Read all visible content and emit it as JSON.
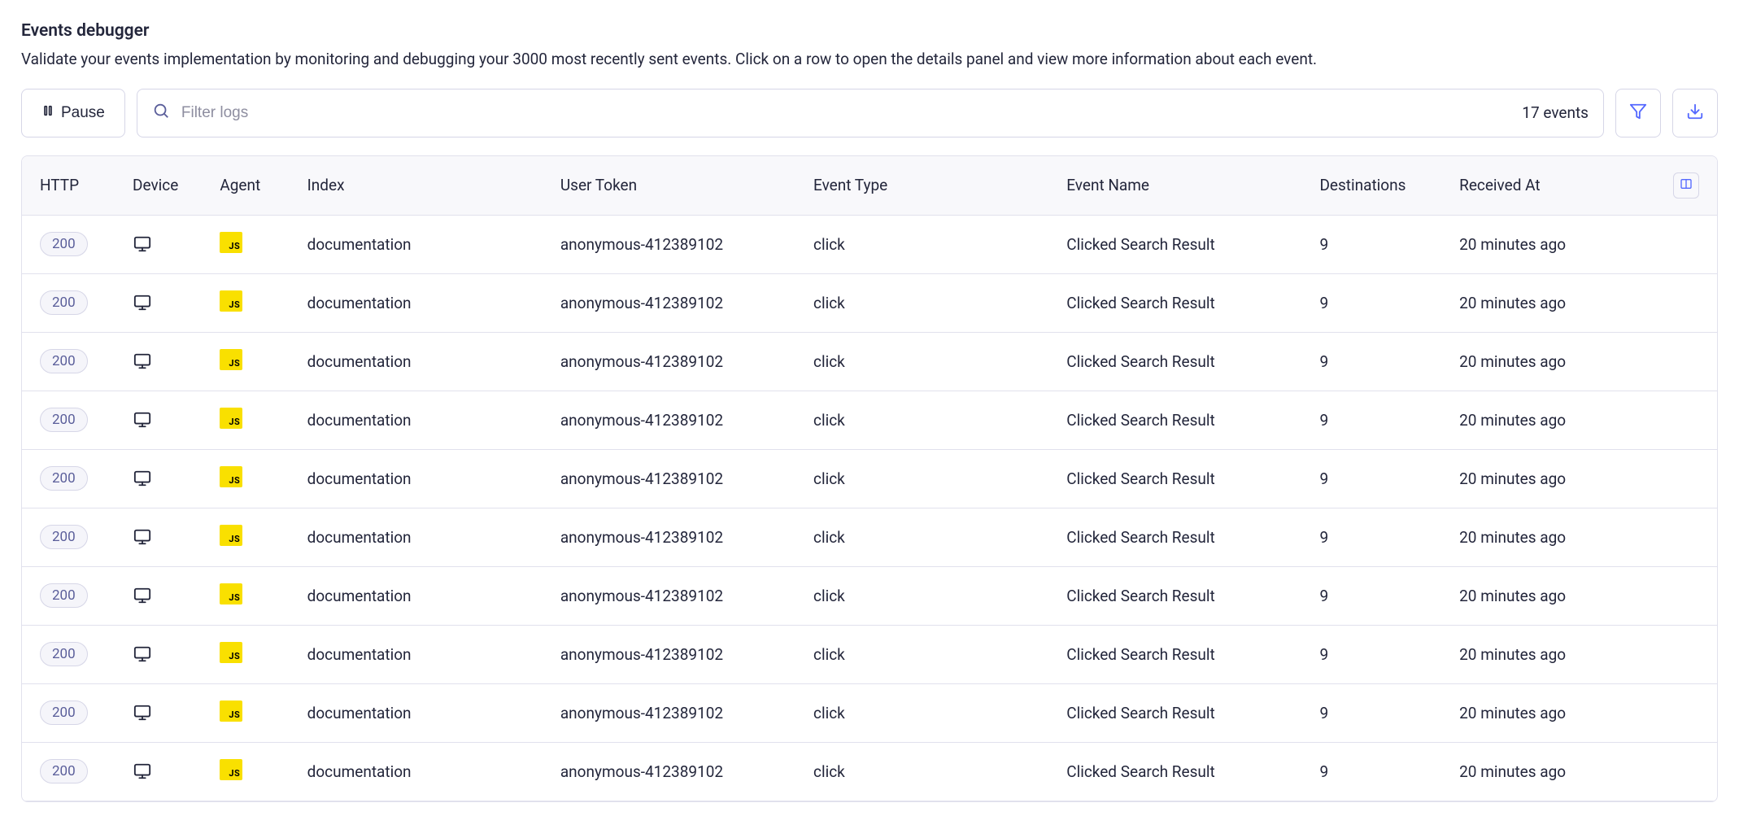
{
  "header": {
    "title": "Events debugger",
    "subtitle": "Validate your events implementation by monitoring and debugging your 3000 most recently sent events. Click on a row to open the details panel and view more information about each event."
  },
  "toolbar": {
    "pause_label": "Pause",
    "search_placeholder": "Filter logs",
    "event_count": "17 events"
  },
  "table": {
    "columns": {
      "http": "HTTP",
      "device": "Device",
      "agent": "Agent",
      "index": "Index",
      "user_token": "User Token",
      "event_type": "Event Type",
      "event_name": "Event Name",
      "destinations": "Destinations",
      "received_at": "Received At"
    },
    "rows": [
      {
        "http": "200",
        "device": "desktop",
        "agent": "JS",
        "index": "documentation",
        "user_token": "anonymous-412389102",
        "event_type": "click",
        "event_name": "Clicked Search Result",
        "destinations": "9",
        "received_at": "20 minutes ago"
      },
      {
        "http": "200",
        "device": "desktop",
        "agent": "JS",
        "index": "documentation",
        "user_token": "anonymous-412389102",
        "event_type": "click",
        "event_name": "Clicked Search Result",
        "destinations": "9",
        "received_at": "20 minutes ago"
      },
      {
        "http": "200",
        "device": "desktop",
        "agent": "JS",
        "index": "documentation",
        "user_token": "anonymous-412389102",
        "event_type": "click",
        "event_name": "Clicked Search Result",
        "destinations": "9",
        "received_at": "20 minutes ago"
      },
      {
        "http": "200",
        "device": "desktop",
        "agent": "JS",
        "index": "documentation",
        "user_token": "anonymous-412389102",
        "event_type": "click",
        "event_name": "Clicked Search Result",
        "destinations": "9",
        "received_at": "20 minutes ago"
      },
      {
        "http": "200",
        "device": "desktop",
        "agent": "JS",
        "index": "documentation",
        "user_token": "anonymous-412389102",
        "event_type": "click",
        "event_name": "Clicked Search Result",
        "destinations": "9",
        "received_at": "20 minutes ago"
      },
      {
        "http": "200",
        "device": "desktop",
        "agent": "JS",
        "index": "documentation",
        "user_token": "anonymous-412389102",
        "event_type": "click",
        "event_name": "Clicked Search Result",
        "destinations": "9",
        "received_at": "20 minutes ago"
      },
      {
        "http": "200",
        "device": "desktop",
        "agent": "JS",
        "index": "documentation",
        "user_token": "anonymous-412389102",
        "event_type": "click",
        "event_name": "Clicked Search Result",
        "destinations": "9",
        "received_at": "20 minutes ago"
      },
      {
        "http": "200",
        "device": "desktop",
        "agent": "JS",
        "index": "documentation",
        "user_token": "anonymous-412389102",
        "event_type": "click",
        "event_name": "Clicked Search Result",
        "destinations": "9",
        "received_at": "20 minutes ago"
      },
      {
        "http": "200",
        "device": "desktop",
        "agent": "JS",
        "index": "documentation",
        "user_token": "anonymous-412389102",
        "event_type": "click",
        "event_name": "Clicked Search Result",
        "destinations": "9",
        "received_at": "20 minutes ago"
      },
      {
        "http": "200",
        "device": "desktop",
        "agent": "JS",
        "index": "documentation",
        "user_token": "anonymous-412389102",
        "event_type": "click",
        "event_name": "Clicked Search Result",
        "destinations": "9",
        "received_at": "20 minutes ago"
      }
    ]
  }
}
